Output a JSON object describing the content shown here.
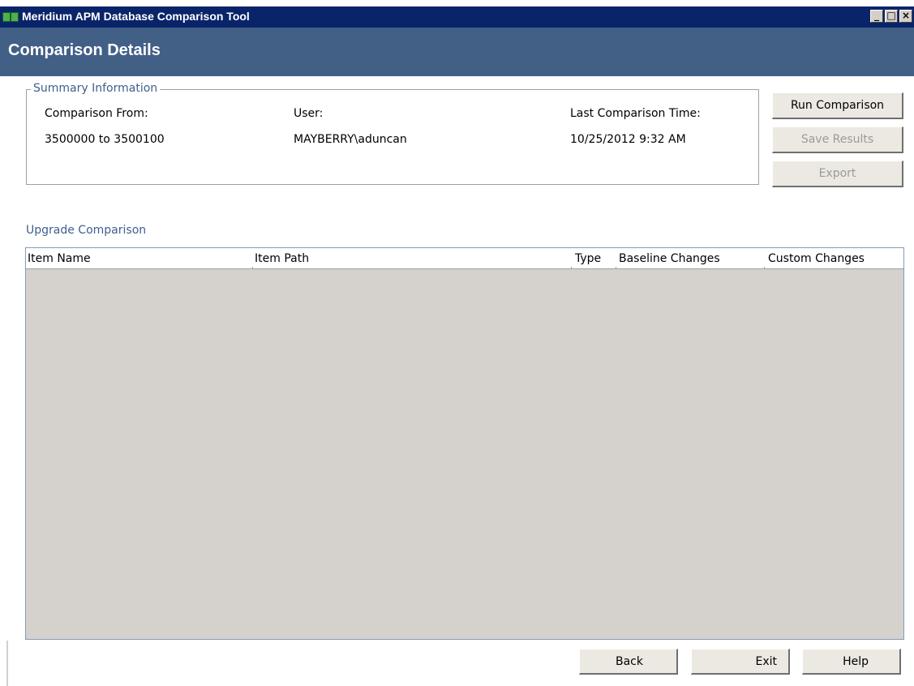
{
  "window": {
    "title": "Meridium APM Database Comparison Tool",
    "controls": {
      "minimize": "_",
      "maximize": "□",
      "close": "×"
    }
  },
  "header": {
    "title": "Comparison Details"
  },
  "summary": {
    "legend": "Summary Information",
    "comparison_from_label": "Comparison From:",
    "comparison_from_value": "3500000 to 3500100",
    "user_label": "User:",
    "user_value": "MAYBERRY\\aduncan",
    "last_time_label": "Last Comparison Time:",
    "last_time_value": "10/25/2012 9:32 AM"
  },
  "actions": {
    "run": "Run Comparison",
    "save": "Save Results",
    "export": "Export"
  },
  "grid": {
    "title": "Upgrade Comparison",
    "columns": [
      "Item Name",
      "Item Path",
      "Type",
      "Baseline Changes",
      "Custom Changes"
    ],
    "rows": []
  },
  "footer": {
    "back": "Back",
    "exit": "Exit",
    "help": "Help"
  },
  "colors": {
    "titlebar": "#0a246a",
    "header_band": "#425f86",
    "section_label": "#3f5f8c",
    "grid_background": "#d5d2ce"
  }
}
